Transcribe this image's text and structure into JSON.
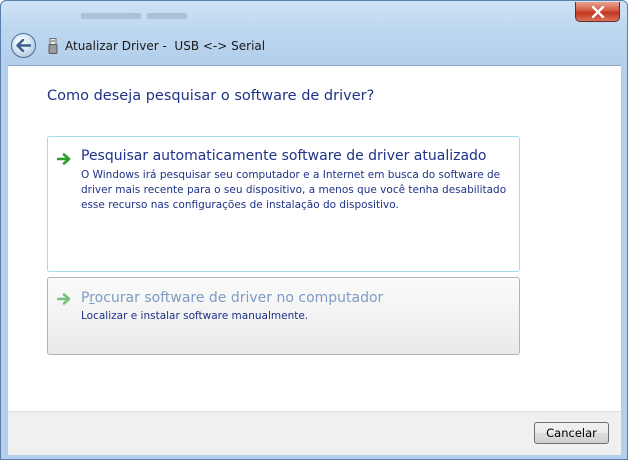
{
  "window": {
    "title": "Atualizar Driver -  USB <-> Serial",
    "close_label": "×"
  },
  "main": {
    "heading": "Como deseja pesquisar o software de driver?",
    "options": [
      {
        "title": "Pesquisar automaticamente software de driver atualizado",
        "description": "O Windows irá pesquisar seu computador e a Internet em busca do software de driver mais recente para o seu dispositivo, a menos que você tenha desabilitado esse recurso nas configurações de instalação do dispositivo."
      },
      {
        "title_first": "P",
        "title_underlined": "r",
        "title_rest": "ocurar software de driver no computador",
        "description": "Localizar e instalar software manualmente."
      }
    ]
  },
  "footer": {
    "cancel_label": "Cancelar"
  },
  "colors": {
    "heading_blue": "#1e3287",
    "arrow_green": "#2ca02c",
    "hover_border": "#a6dbef"
  },
  "icons": [
    "back-arrow-icon",
    "usb-icon",
    "close-icon",
    "green-arrow-icon"
  ]
}
